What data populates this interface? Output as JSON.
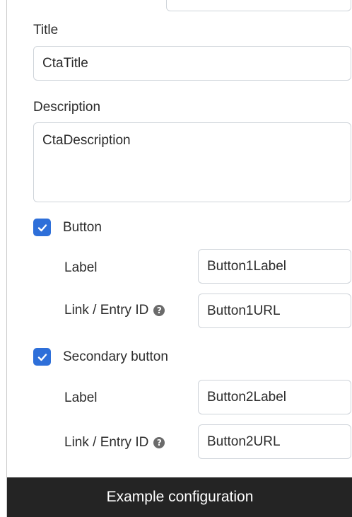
{
  "form": {
    "title_label": "Title",
    "title_value": "CtaTitle",
    "description_label": "Description",
    "description_value": "CtaDescription",
    "button": {
      "checkbox_label": "Button",
      "checked": true,
      "label_label": "Label",
      "label_value": "Button1Label",
      "link_label": "Link / Entry ID",
      "link_value": "Button1URL"
    },
    "secondary_button": {
      "checkbox_label": "Secondary button",
      "checked": true,
      "label_label": "Label",
      "label_value": "Button2Label",
      "link_label": "Link / Entry ID",
      "link_value": "Button2URL"
    }
  },
  "footer": {
    "text": "Example configuration"
  },
  "icons": {
    "help": "help-icon",
    "check": "check-icon"
  },
  "colors": {
    "accent": "#2e6fd9",
    "footer_bg": "#242424",
    "border": "#cfd4da"
  }
}
